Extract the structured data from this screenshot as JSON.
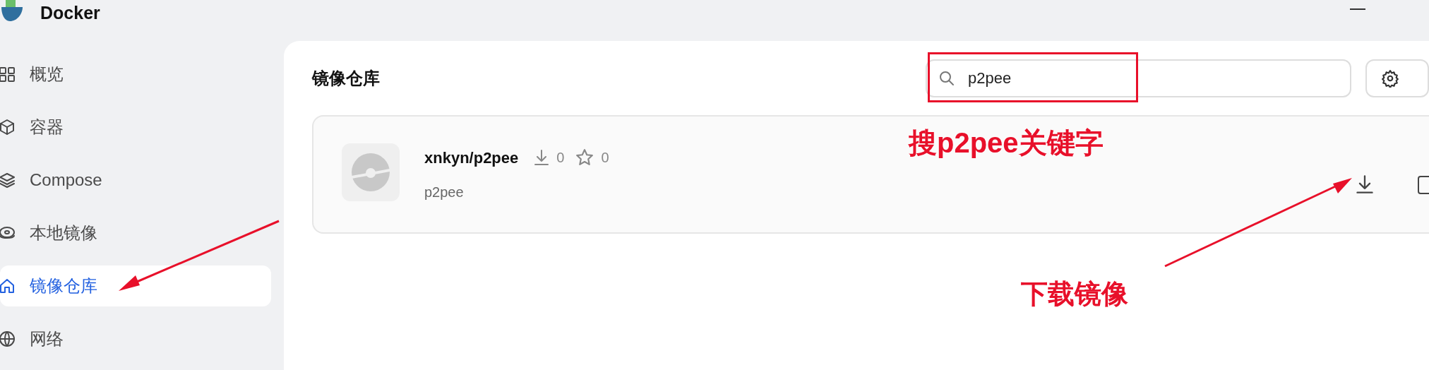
{
  "window": {
    "title": "Docker"
  },
  "sidebar": {
    "items": [
      {
        "label": "概览",
        "selected": false
      },
      {
        "label": "容器",
        "selected": false
      },
      {
        "label": "Compose",
        "selected": false
      },
      {
        "label": "本地镜像",
        "selected": false
      },
      {
        "label": "镜像仓库",
        "selected": true
      },
      {
        "label": "网络",
        "selected": false
      }
    ]
  },
  "main": {
    "title": "镜像仓库",
    "search": {
      "value": "p2pee"
    },
    "results": [
      {
        "name": "xnkyn/p2pee",
        "downloads": "0",
        "stars": "0",
        "description": "p2pee"
      }
    ]
  },
  "annotations": [
    {
      "kind": "note",
      "text": "搜p2pee关键字"
    },
    {
      "kind": "note",
      "text": "下载镜像"
    }
  ]
}
